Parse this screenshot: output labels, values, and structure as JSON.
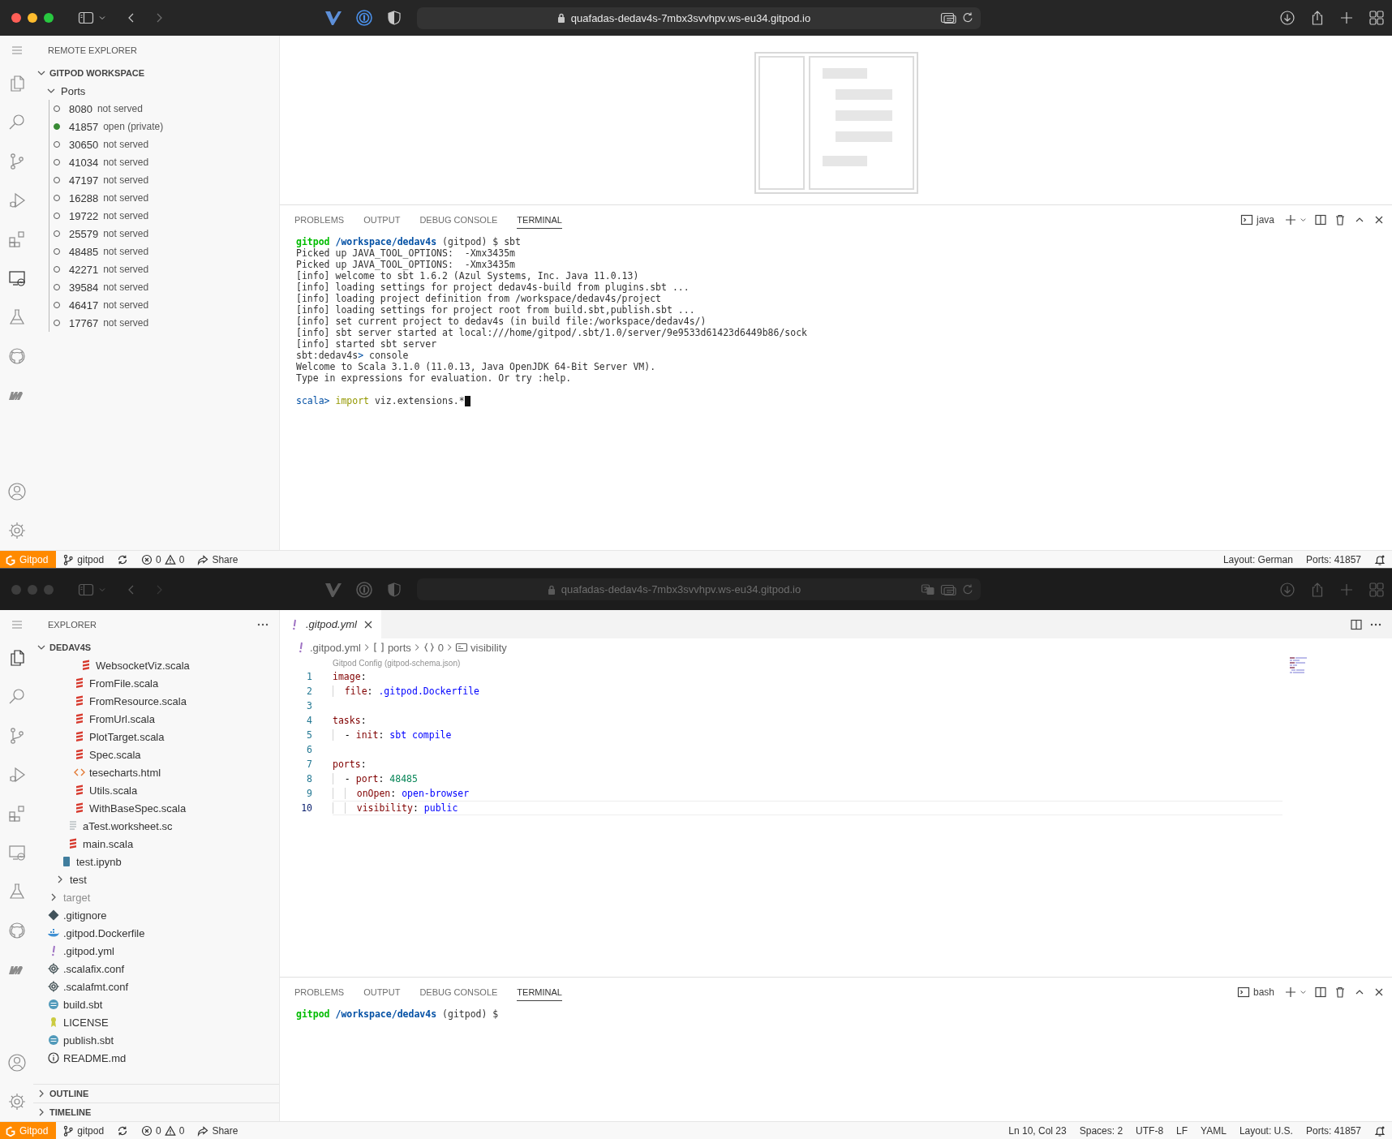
{
  "windows": [
    {
      "browser": {
        "focused": true,
        "url": "quafadas-dedav4s-7mbx3svvhpv.ws-eu34.gitpod.io",
        "translate": false
      },
      "activity_bar": [
        {
          "selected": false
        },
        {
          "selected": false
        },
        {
          "selected": false
        },
        {
          "selected": false
        },
        {
          "selected": false
        },
        {
          "selected": true
        },
        {
          "selected": false
        },
        {
          "selected": false
        },
        {
          "selected": false
        }
      ],
      "sidebar": {
        "kind": "remote",
        "title": "REMOTE EXPLORER",
        "sections": [
          {
            "kind": "ports",
            "title": "GITPOD WORKSPACE",
            "expanded": true,
            "groups": [
              {
                "label": "Ports",
                "expanded": true,
                "ports": [
                  {
                    "port": "8080",
                    "status": "not served",
                    "open": false
                  },
                  {
                    "port": "41857",
                    "status": "open (private)",
                    "open": true
                  },
                  {
                    "port": "30650",
                    "status": "not served",
                    "open": false
                  },
                  {
                    "port": "41034",
                    "status": "not served",
                    "open": false
                  },
                  {
                    "port": "47197",
                    "status": "not served",
                    "open": false
                  },
                  {
                    "port": "16288",
                    "status": "not served",
                    "open": false
                  },
                  {
                    "port": "19722",
                    "status": "not served",
                    "open": false
                  },
                  {
                    "port": "25579",
                    "status": "not served",
                    "open": false
                  },
                  {
                    "port": "48485",
                    "status": "not served",
                    "open": false
                  },
                  {
                    "port": "42271",
                    "status": "not served",
                    "open": false
                  },
                  {
                    "port": "39584",
                    "status": "not served",
                    "open": false
                  },
                  {
                    "port": "46417",
                    "status": "not served",
                    "open": false
                  },
                  {
                    "port": "17767",
                    "status": "not served",
                    "open": false
                  }
                ]
              }
            ]
          }
        ]
      },
      "editor": {
        "kind": "empty"
      },
      "panel": {
        "tabs": [
          {
            "label": "PROBLEMS",
            "selected": false
          },
          {
            "label": "OUTPUT",
            "selected": false
          },
          {
            "label": "DEBUG CONSOLE",
            "selected": false
          },
          {
            "label": "TERMINAL",
            "selected": true
          }
        ],
        "terminal": "java",
        "lines": [
          {
            "kind": "text",
            "segments": [
              {
                "text": "gitpod",
                "kind": "user"
              },
              {
                "text": " /workspace/dedav4s",
                "kind": "path"
              },
              {
                "text": " (gitpod) $ sbt",
                "kind": "plain"
              }
            ]
          },
          {
            "kind": "text",
            "segments": [
              {
                "text": "Picked up JAVA_TOOL_OPTIONS:  -Xmx3435m",
                "kind": "plain"
              }
            ]
          },
          {
            "kind": "text",
            "segments": [
              {
                "text": "Picked up JAVA_TOOL_OPTIONS:  -Xmx3435m",
                "kind": "plain"
              }
            ]
          },
          {
            "kind": "text",
            "segments": [
              {
                "text": "[info] welcome to sbt 1.6.2 (Azul Systems, Inc. Java 11.0.13)",
                "kind": "plain"
              }
            ]
          },
          {
            "kind": "text",
            "segments": [
              {
                "text": "[info] loading settings for project dedav4s-build from plugins.sbt ...",
                "kind": "plain"
              }
            ]
          },
          {
            "kind": "text",
            "segments": [
              {
                "text": "[info] loading project definition from /workspace/dedav4s/project",
                "kind": "plain"
              }
            ]
          },
          {
            "kind": "text",
            "segments": [
              {
                "text": "[info] loading settings for project root from build.sbt,publish.sbt ...",
                "kind": "plain"
              }
            ]
          },
          {
            "kind": "text",
            "segments": [
              {
                "text": "[info] set current project to dedav4s (in build file:/workspace/dedav4s/)",
                "kind": "plain"
              }
            ]
          },
          {
            "kind": "text",
            "segments": [
              {
                "text": "[info] sbt server started at local:///home/gitpod/.sbt/1.0/server/9e9533d61423d6449b86/sock",
                "kind": "plain"
              }
            ]
          },
          {
            "kind": "text",
            "segments": [
              {
                "text": "[info] started sbt server",
                "kind": "plain"
              }
            ]
          },
          {
            "kind": "text",
            "segments": [
              {
                "text": "sbt:dedav4s",
                "kind": "plain"
              },
              {
                "text": ">",
                "kind": "prompt"
              },
              {
                "text": " console",
                "kind": "plain"
              }
            ]
          },
          {
            "kind": "text",
            "segments": [
              {
                "text": "Welcome to Scala 3.1.0 (11.0.13, Java OpenJDK 64-Bit Server VM).",
                "kind": "plain"
              }
            ]
          },
          {
            "kind": "text",
            "segments": [
              {
                "text": "Type in expressions for evaluation. Or try :help.",
                "kind": "plain"
              }
            ]
          },
          {
            "kind": "blank"
          },
          {
            "kind": "text",
            "cursor": true,
            "segments": [
              {
                "text": "scala>",
                "kind": "prompt"
              },
              {
                "text": " import",
                "kind": "keyword"
              },
              {
                "text": " viz.extensions.*",
                "kind": "plain"
              }
            ]
          }
        ]
      },
      "status_bar": {
        "remote": "Gitpod",
        "branch": "gitpod",
        "errors": "0",
        "warnings": "0",
        "share": "Share",
        "right": [
          "Layout: German",
          "Ports: 41857"
        ]
      }
    },
    {
      "browser": {
        "focused": false,
        "url": "quafadas-dedav4s-7mbx3svvhpv.ws-eu34.gitpod.io",
        "translate": true
      },
      "activity_bar": [
        {
          "selected": true
        },
        {
          "selected": false
        },
        {
          "selected": false
        },
        {
          "selected": false
        },
        {
          "selected": false
        },
        {
          "selected": false
        },
        {
          "selected": false
        },
        {
          "selected": false
        },
        {
          "selected": false
        }
      ],
      "sidebar": {
        "kind": "explorer",
        "title": "EXPLORER",
        "sections": [
          {
            "kind": "files",
            "title": "DEDAV4S",
            "expanded": true,
            "tree": [
              {
                "children": [
                  {
                    "children": [
                      {
                        "children": [
                          {
                            "children": [
                              {
                                "children": [
                                  {
                                    "label": "WebsocketViz.scala",
                                    "kind": "scala"
                                  }
                                ]
                              },
                              {
                                "label": "FromFile.scala",
                                "kind": "scala"
                              },
                              {
                                "label": "FromResource.scala",
                                "kind": "scala"
                              },
                              {
                                "label": "FromUrl.scala",
                                "kind": "scala"
                              },
                              {
                                "label": "PlotTarget.scala",
                                "kind": "scala"
                              },
                              {
                                "label": "Spec.scala",
                                "kind": "scala"
                              },
                              {
                                "label": "tesecharts.html",
                                "kind": "html"
                              },
                              {
                                "label": "Utils.scala",
                                "kind": "scala"
                              },
                              {
                                "label": "WithBaseSpec.scala",
                                "kind": "scala"
                              }
                            ]
                          },
                          {
                            "label": "aTest.worksheet.sc",
                            "kind": "worksheet"
                          },
                          {
                            "label": "main.scala",
                            "kind": "scala"
                          }
                        ]
                      },
                      {
                        "label": "test.ipynb",
                        "kind": "notebook"
                      }
                    ]
                  },
                  {
                    "label": "test",
                    "expanded": false
                  }
                ]
              },
              {
                "label": "target",
                "expanded": false,
                "ignored": true
              },
              {
                "label": ".gitignore",
                "kind": "git"
              },
              {
                "label": ".gitpod.Dockerfile",
                "kind": "docker"
              },
              {
                "label": ".gitpod.yml",
                "kind": "yaml"
              },
              {
                "label": ".scalafix.conf",
                "kind": "conf"
              },
              {
                "label": ".scalafmt.conf",
                "kind": "conf"
              },
              {
                "label": "build.sbt",
                "kind": "sbt"
              },
              {
                "label": "LICENSE",
                "kind": "license"
              },
              {
                "label": "publish.sbt",
                "kind": "sbt"
              },
              {
                "label": "README.md",
                "kind": "info"
              }
            ]
          },
          {
            "title": "OUTLINE",
            "expanded": false
          },
          {
            "title": "TIMELINE",
            "expanded": false
          }
        ]
      },
      "editor": {
        "kind": "text",
        "tabs": [
          {
            "label": ".gitpod.yml",
            "selected": true,
            "preview": true
          }
        ],
        "breadcrumbs": [
          {
            "label": ".gitpod.yml",
            "kind": "yaml"
          },
          {
            "label": "ports",
            "kind": "array"
          },
          {
            "label": "0",
            "kind": "object"
          },
          {
            "label": "visibility",
            "kind": "string"
          }
        ],
        "codelens": "Gitpod Config (gitpod-schema.json)",
        "lines": [
          {
            "number": "1",
            "current": false,
            "tokens": [
              {
                "text": "image",
                "kind": "key"
              },
              {
                "text": ":",
                "kind": "plain"
              }
            ]
          },
          {
            "number": "2",
            "current": false,
            "tokens": [
              {
                "text": "  file",
                "kind": "key"
              },
              {
                "text": ": ",
                "kind": "plain"
              },
              {
                "text": ".gitpod.Dockerfile",
                "kind": "string"
              }
            ]
          },
          {
            "number": "3",
            "current": false
          },
          {
            "number": "4",
            "current": false,
            "tokens": [
              {
                "text": "tasks",
                "kind": "key"
              },
              {
                "text": ":",
                "kind": "plain"
              }
            ]
          },
          {
            "number": "5",
            "current": false,
            "tokens": [
              {
                "text": "  - ",
                "kind": "plain"
              },
              {
                "text": "init",
                "kind": "key"
              },
              {
                "text": ": ",
                "kind": "plain"
              },
              {
                "text": "sbt compile",
                "kind": "string"
              }
            ]
          },
          {
            "number": "6",
            "current": false
          },
          {
            "number": "7",
            "current": false,
            "tokens": [
              {
                "text": "ports",
                "kind": "key"
              },
              {
                "text": ":",
                "kind": "plain"
              }
            ]
          },
          {
            "number": "8",
            "current": false,
            "tokens": [
              {
                "text": "  - ",
                "kind": "plain"
              },
              {
                "text": "port",
                "kind": "key"
              },
              {
                "text": ": ",
                "kind": "plain"
              },
              {
                "text": "48485",
                "kind": "number"
              }
            ]
          },
          {
            "number": "9",
            "current": false,
            "tokens": [
              {
                "text": "    onOpen",
                "kind": "key"
              },
              {
                "text": ": ",
                "kind": "plain"
              },
              {
                "text": "open-browser",
                "kind": "string"
              }
            ]
          },
          {
            "number": "10",
            "current": true,
            "tokens": [
              {
                "text": "    visibility",
                "kind": "key"
              },
              {
                "text": ": ",
                "kind": "plain"
              },
              {
                "text": "public",
                "kind": "string"
              }
            ]
          }
        ]
      },
      "panel": {
        "tabs": [
          {
            "label": "PROBLEMS",
            "selected": false
          },
          {
            "label": "OUTPUT",
            "selected": false
          },
          {
            "label": "DEBUG CONSOLE",
            "selected": false
          },
          {
            "label": "TERMINAL",
            "selected": true
          }
        ],
        "terminal": "bash",
        "lines": [
          {
            "kind": "text",
            "segments": [
              {
                "text": "gitpod",
                "kind": "user"
              },
              {
                "text": " /workspace/dedav4s",
                "kind": "path"
              },
              {
                "text": " (gitpod) $",
                "kind": "plain"
              }
            ]
          }
        ]
      },
      "status_bar": {
        "remote": "Gitpod",
        "branch": "gitpod",
        "errors": "0",
        "warnings": "0",
        "share": "Share",
        "right": [
          "Ln 10, Col 23",
          "Spaces: 2",
          "UTF-8",
          "LF",
          "YAML",
          "Layout: U.S.",
          "Ports: 41857"
        ]
      }
    }
  ]
}
